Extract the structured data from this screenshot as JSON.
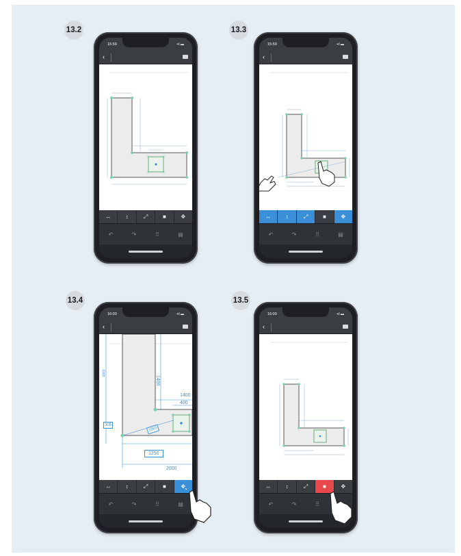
{
  "steps": [
    {
      "label": "13.2",
      "time": "15:59",
      "toolbar_active": [],
      "red_button": false
    },
    {
      "label": "13.3",
      "time": "15:59",
      "toolbar_active": [
        0,
        1,
        2,
        4
      ],
      "red_button": false
    },
    {
      "label": "13.4",
      "time": "16:00",
      "toolbar_active": [
        4
      ],
      "red_button": false
    },
    {
      "label": "13.5",
      "time": "16:00",
      "toolbar_active": [],
      "red_button": true
    }
  ],
  "toolbar": {
    "row1": [
      {
        "icon": "horizontal-arrows-icon",
        "glyph": "↔"
      },
      {
        "icon": "vertical-arrow-icon",
        "glyph": "↕"
      },
      {
        "icon": "diagonal-arrows-icon",
        "glyph": "⤢"
      },
      {
        "icon": "trash-icon",
        "glyph": "■"
      },
      {
        "icon": "move-icon",
        "glyph": "✥"
      }
    ],
    "row2": [
      {
        "icon": "undo-icon",
        "glyph": "↶"
      },
      {
        "icon": "redo-icon",
        "glyph": "↷"
      },
      {
        "icon": "grid-icon",
        "glyph": "⠿"
      },
      {
        "icon": "document-icon",
        "glyph": "▤"
      }
    ]
  },
  "status": {
    "signal": "•ıl ▬"
  },
  "dimensions": {
    "d_1400": "1400",
    "d_400": "400",
    "d_2000": "2000",
    "d_1250": "1250",
    "d_305": "305",
    "d_1065": "1065",
    "d_4000": "4000"
  },
  "colors": {
    "accent": "#3b8fd8",
    "delete": "#e8484b",
    "point": "#7fd0b0",
    "dim": "#3b8fd8"
  }
}
